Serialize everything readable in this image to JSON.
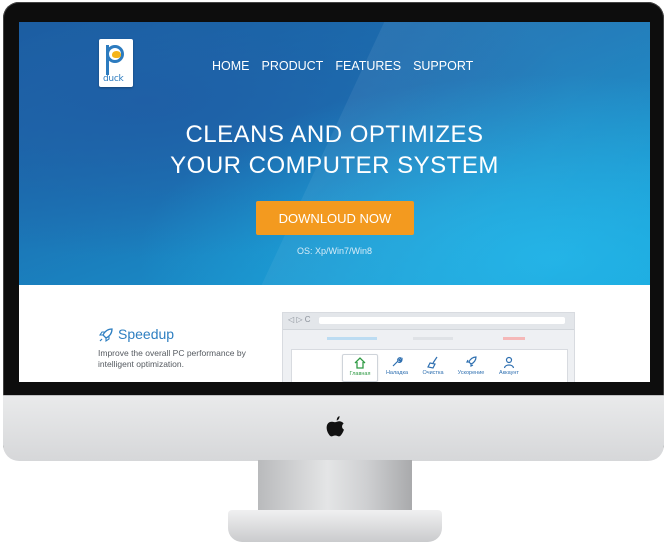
{
  "logo": {
    "text": "duck"
  },
  "nav": {
    "items": [
      "HOME",
      "PRODUCT",
      "FEATURES",
      "SUPPORT"
    ]
  },
  "hero": {
    "headline_line1": "CLEANS AND OPTIMIZES",
    "headline_line2": "YOUR COMPUTER SYSTEM",
    "download_label": "DOWNLOUD NOW",
    "os_text": "OS: Xp/Win7/Win8"
  },
  "feature": {
    "icon": "rocket-icon",
    "title": "Speedup",
    "description": "Improve the overall PC performance by intelligent optimization."
  },
  "preview": {
    "nav_glyphs": "◁ ▷  C",
    "tabs": [
      {
        "label": "Главная",
        "icon": "home-icon",
        "active": true
      },
      {
        "label": "Наладка",
        "icon": "wrench-icon",
        "active": false
      },
      {
        "label": "Очистка",
        "icon": "broom-icon",
        "active": false
      },
      {
        "label": "Ускорение",
        "icon": "rocket-icon",
        "active": false
      },
      {
        "label": "Аккаунт",
        "icon": "user-icon",
        "active": false
      }
    ]
  },
  "colors": {
    "accent_orange": "#f39a1f",
    "accent_blue": "#2e7fc1",
    "hero_blue": "#1b78b8"
  }
}
